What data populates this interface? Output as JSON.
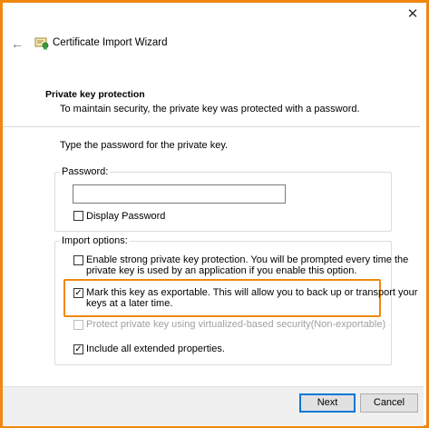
{
  "window": {
    "close_glyph": "✕",
    "back_glyph": "←",
    "title": "Certificate Import Wizard"
  },
  "header": {
    "section_title": "Private key protection",
    "section_description": "To maintain security, the private key was protected with a password."
  },
  "main": {
    "prompt": "Type the password for the private key.",
    "password_group": {
      "label": "Password:",
      "value": "",
      "display_password_label": "Display Password",
      "display_password_checked": false
    },
    "import_options": {
      "label": "Import options:",
      "options": [
        {
          "line1": "Enable strong private key protection. You will be prompted every time the",
          "line2": "private key is used by an application if you enable this option.",
          "checked": false,
          "enabled": true
        },
        {
          "line1": "Mark this key as exportable. This will allow you to back up or transport your",
          "line2": "keys at a later time.",
          "checked": true,
          "enabled": true
        },
        {
          "line1": "Protect private key using virtualized-based security(Non-exportable)",
          "line2": "",
          "checked": false,
          "enabled": false
        },
        {
          "line1": "Include all extended properties.",
          "line2": "",
          "checked": true,
          "enabled": true
        }
      ]
    }
  },
  "footer": {
    "next_label": "Next",
    "cancel_label": "Cancel"
  },
  "colors": {
    "highlight": "#f0880f",
    "primary_border": "#0078d7"
  },
  "check_glyph": "✓"
}
